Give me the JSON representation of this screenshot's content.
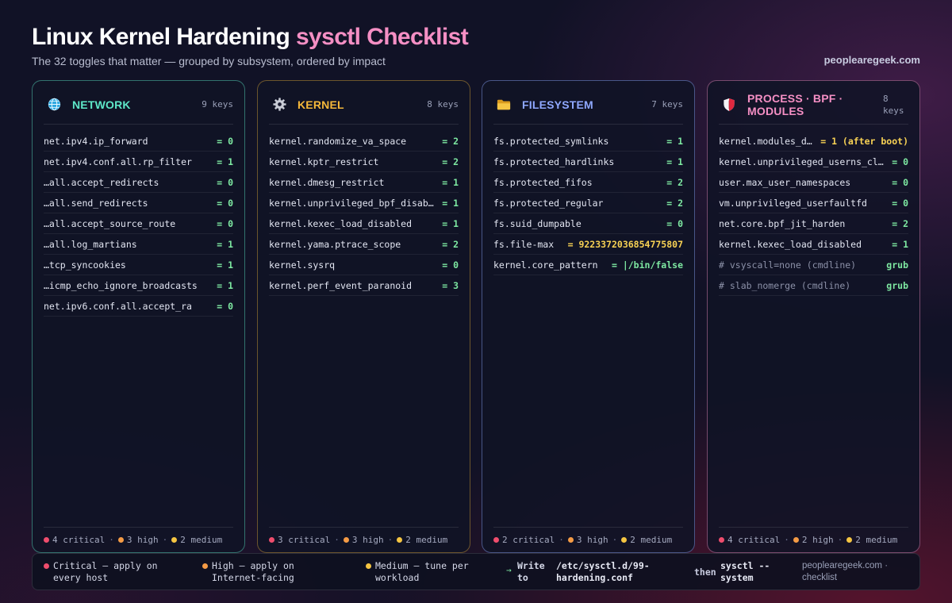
{
  "header": {
    "title_main": "Linux Kernel Hardening",
    "title_accent": "sysctl Checklist",
    "subtitle": "The 32 toggles that matter — grouped by subsystem, ordered by impact",
    "brand": "peoplearegeek.com"
  },
  "colors": {
    "critical": "#ef4d6d",
    "high": "#f59b45",
    "medium": "#f5c542",
    "value_green": "#7ee9a2",
    "value_yellow": "#f7d154",
    "network": "#5ee7c8",
    "kernel": "#f5b83a",
    "filesystem": "#8fa8ff",
    "process": "#f58fc4"
  },
  "cards": {
    "network": {
      "icon": "globe-icon",
      "title": "NETWORK",
      "count": "9 keys",
      "rows": [
        {
          "k": "net.ipv4.ip_forward",
          "v": "= 0"
        },
        {
          "k": "net.ipv4.conf.all.rp_filter",
          "v": "= 1"
        },
        {
          "k": "…all.accept_redirects",
          "v": "= 0"
        },
        {
          "k": "…all.send_redirects",
          "v": "= 0"
        },
        {
          "k": "…all.accept_source_route",
          "v": "= 0"
        },
        {
          "k": "…all.log_martians",
          "v": "= 1"
        },
        {
          "k": "…tcp_syncookies",
          "v": "= 1"
        },
        {
          "k": "…icmp_echo_ignore_broadcasts",
          "v": "= 1"
        },
        {
          "k": "net.ipv6.conf.all.accept_ra",
          "v": "= 0"
        }
      ],
      "footer": {
        "critical": "4 critical",
        "high": "3 high",
        "medium": "2 medium"
      }
    },
    "kernel": {
      "icon": "gear-icon",
      "title": "KERNEL",
      "count": "8 keys",
      "rows": [
        {
          "k": "kernel.randomize_va_space",
          "v": "= 2"
        },
        {
          "k": "kernel.kptr_restrict",
          "v": "= 2"
        },
        {
          "k": "kernel.dmesg_restrict",
          "v": "= 1"
        },
        {
          "k": "kernel.unprivileged_bpf_disab…",
          "v": "= 1"
        },
        {
          "k": "kernel.kexec_load_disabled",
          "v": "= 1"
        },
        {
          "k": "kernel.yama.ptrace_scope",
          "v": "= 2"
        },
        {
          "k": "kernel.sysrq",
          "v": "= 0"
        },
        {
          "k": "kernel.perf_event_paranoid",
          "v": "= 3"
        }
      ],
      "footer": {
        "critical": "3 critical",
        "high": "3 high",
        "medium": "2 medium"
      }
    },
    "filesystem": {
      "icon": "folder-icon",
      "title": "FILESYSTEM",
      "count": "7 keys",
      "rows": [
        {
          "k": "fs.protected_symlinks",
          "v": "= 1"
        },
        {
          "k": "fs.protected_hardlinks",
          "v": "= 1"
        },
        {
          "k": "fs.protected_fifos",
          "v": "= 2"
        },
        {
          "k": "fs.protected_regular",
          "v": "= 2"
        },
        {
          "k": "fs.suid_dumpable",
          "v": "= 0"
        },
        {
          "k": "fs.file-max",
          "v": "= 9223372036854775807"
        },
        {
          "k": "kernel.core_pattern",
          "v": "= |/bin/false"
        }
      ],
      "footer": {
        "critical": "2 critical",
        "high": "3 high",
        "medium": "2 medium"
      }
    },
    "process": {
      "icon": "shield-icon",
      "title": "PROCESS · BPF · MODULES",
      "count": "8 keys",
      "rows": [
        {
          "k": "kernel.modules_d…",
          "v": "= 1 (after boot)"
        },
        {
          "k": "kernel.unprivileged_userns_cl…",
          "v": "= 0"
        },
        {
          "k": "user.max_user_namespaces",
          "v": "= 0"
        },
        {
          "k": "vm.unprivileged_userfaultfd",
          "v": "= 0"
        },
        {
          "k": "net.core.bpf_jit_harden",
          "v": "= 2"
        },
        {
          "k": "kernel.kexec_load_disabled",
          "v": "= 1"
        },
        {
          "k": "# vsyscall=none (cmdline)",
          "v": "grub"
        },
        {
          "k": "# slab_nomerge (cmdline)",
          "v": "grub"
        }
      ],
      "footer": {
        "critical": "4 critical",
        "high": "2 high",
        "medium": "2 medium"
      }
    }
  },
  "legend": {
    "critical": "Critical — apply on every host",
    "high": "High — apply on Internet-facing",
    "medium": "Medium — tune per workload",
    "write_to": "Write to",
    "path": "/etc/sysctl.d/99-hardening.conf",
    "then": "then",
    "command": "sysctl --system",
    "brand": "peoplearegeek.com · checklist"
  }
}
